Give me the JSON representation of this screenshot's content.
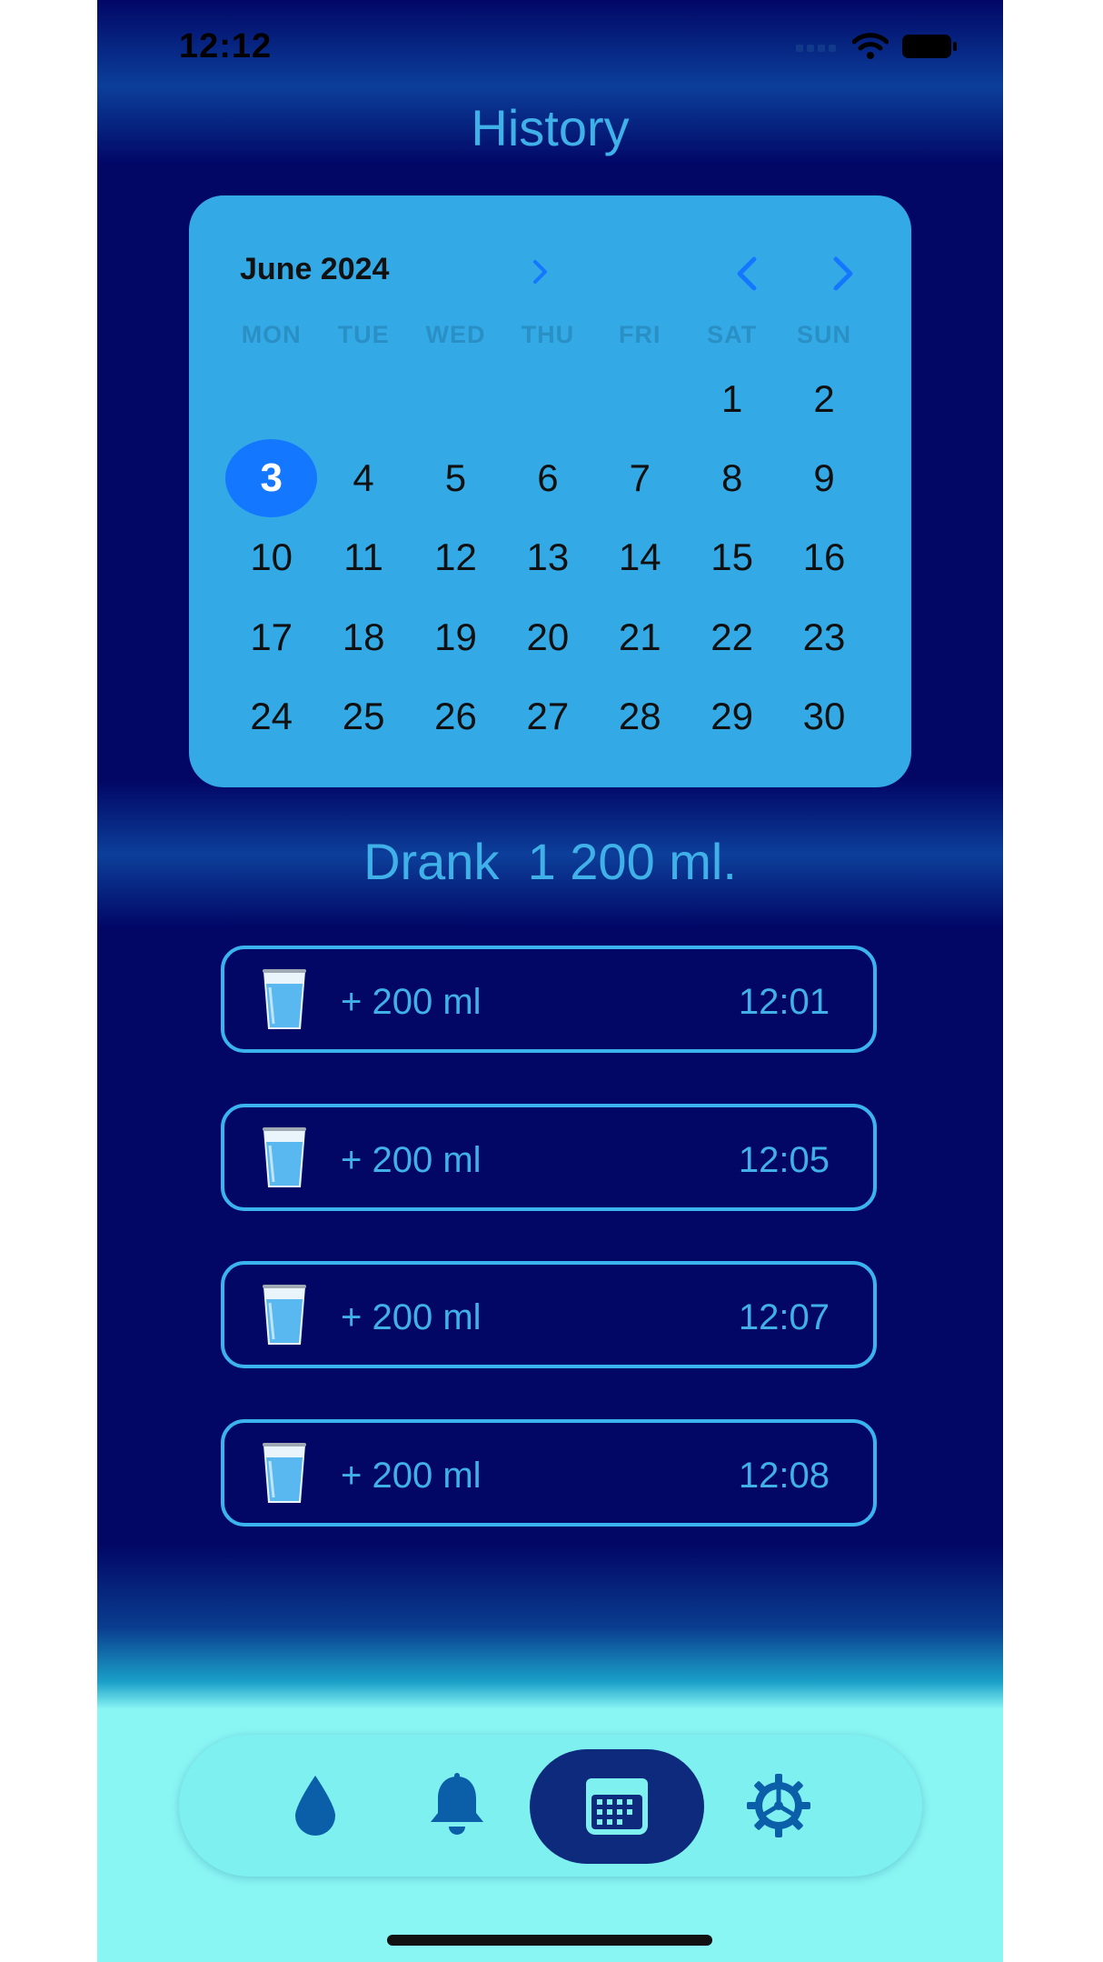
{
  "status_bar": {
    "time": "12:12"
  },
  "header": {
    "title": "History"
  },
  "calendar": {
    "month_label": "June 2024",
    "weekdays": [
      "MON",
      "TUE",
      "WED",
      "THU",
      "FRI",
      "SAT",
      "SUN"
    ],
    "days": [
      "",
      "",
      "",
      "",
      "",
      "1",
      "2",
      "3",
      "4",
      "5",
      "6",
      "7",
      "8",
      "9",
      "10",
      "11",
      "12",
      "13",
      "14",
      "15",
      "16",
      "17",
      "18",
      "19",
      "20",
      "21",
      "22",
      "23",
      "24",
      "25",
      "26",
      "27",
      "28",
      "29",
      "30"
    ],
    "selected_day": "3"
  },
  "summary": {
    "drank_label": "Drank",
    "drank_amount": "1 200 ml."
  },
  "entries": [
    {
      "amount": "+  200 ml",
      "time": "12:01"
    },
    {
      "amount": "+  200 ml",
      "time": "12:05"
    },
    {
      "amount": "+  200 ml",
      "time": "12:07"
    },
    {
      "amount": "+  200 ml",
      "time": "12:08"
    }
  ],
  "tabbar": {
    "items": [
      {
        "icon": "water-drop-icon",
        "active": false
      },
      {
        "icon": "bell-icon",
        "active": false
      },
      {
        "icon": "calendar-icon",
        "active": true
      },
      {
        "icon": "gear-icon",
        "active": false
      }
    ]
  },
  "colors": {
    "accent": "#3fb0e8",
    "background": "#020766",
    "calendar_bg": "#33aae6",
    "selected": "#1477ff",
    "tabbar_bg": "#7ef0ef"
  }
}
